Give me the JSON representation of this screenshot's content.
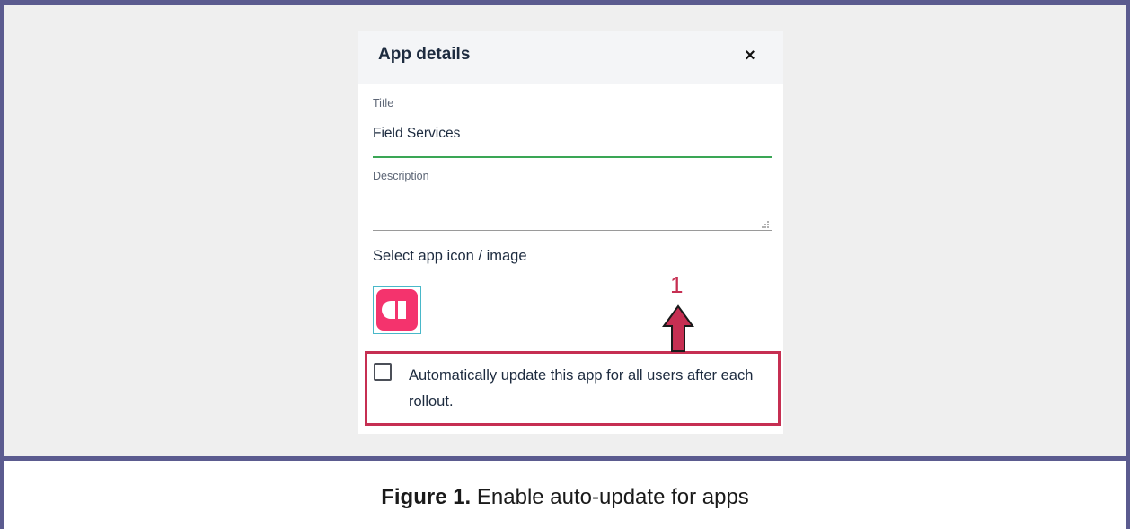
{
  "dialog": {
    "title": "App details",
    "close_symbol": "×",
    "title_field": {
      "label": "Title",
      "value": "Field Services"
    },
    "description_field": {
      "label": "Description",
      "value": ""
    },
    "icon_section": {
      "label": "Select app icon / image",
      "icon": "app-icon",
      "icon_color": "#f4336d"
    },
    "auto_update": {
      "checked": false,
      "label": "Automatically update this app for all users after each rollout."
    }
  },
  "annotation": {
    "number": "1",
    "color": "#c62f52"
  },
  "caption": {
    "prefix": "Figure 1.",
    "text": " Enable auto-update for apps"
  }
}
